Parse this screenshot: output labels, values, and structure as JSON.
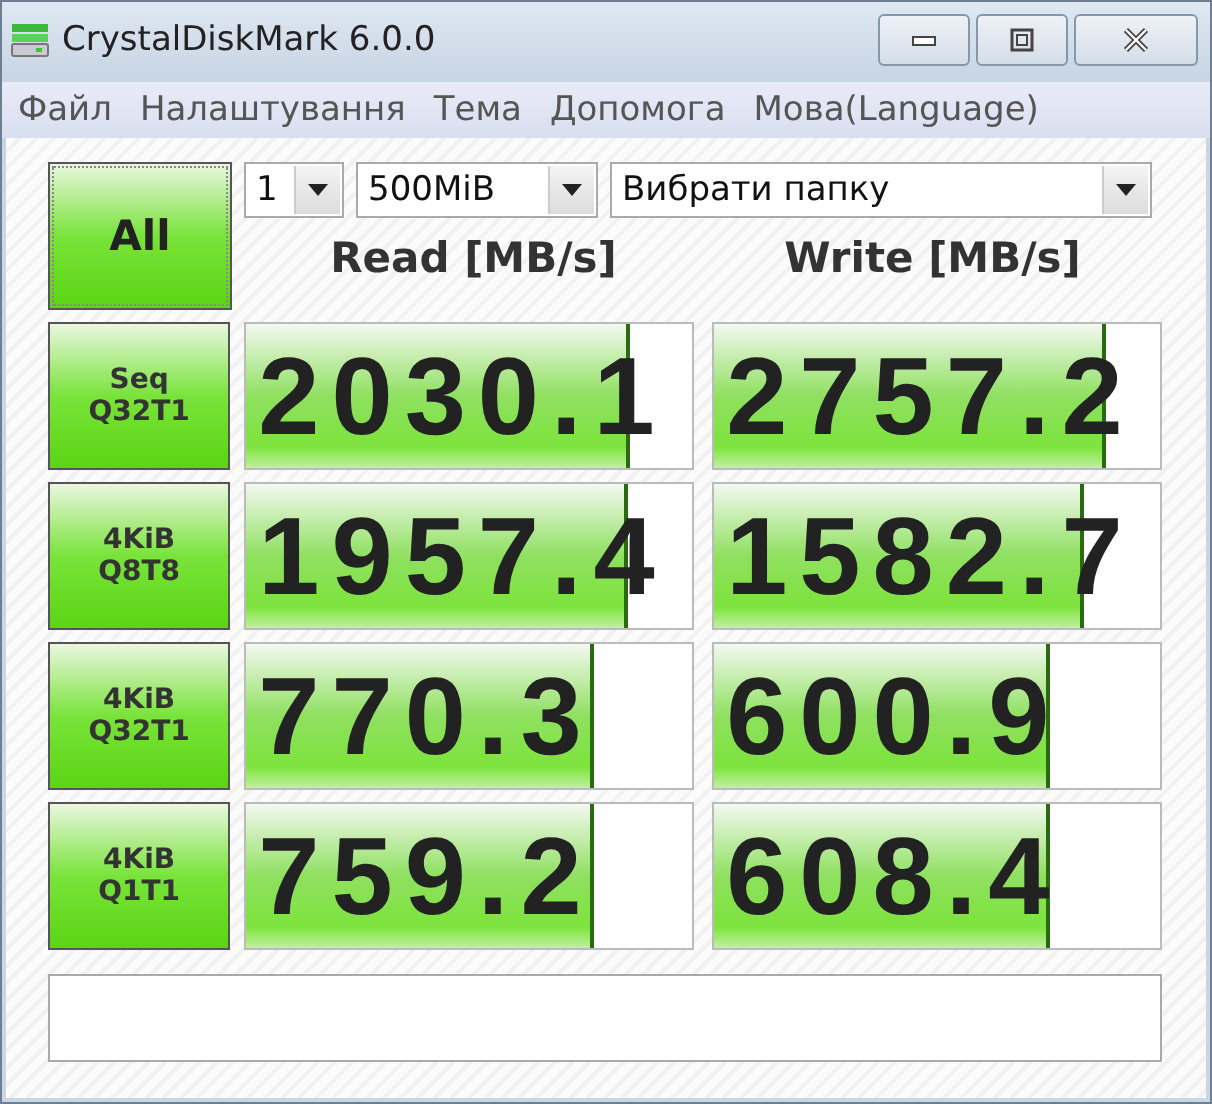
{
  "window": {
    "title": "CrystalDiskMark 6.0.0"
  },
  "menu": [
    "Файл",
    "Налаштування",
    "Тема",
    "Допомога",
    "Мова(Language)"
  ],
  "all_button": {
    "label": "All"
  },
  "selects": [
    {
      "kind": "count",
      "value": "1"
    },
    {
      "kind": "size",
      "value": "500MiB"
    },
    {
      "kind": "folder",
      "value": "Вибрати папку"
    }
  ],
  "columns": [
    "Read [MB/s]",
    "Write [MB/s]"
  ],
  "rows": [
    {
      "label": [
        "Seq",
        "Q32T1"
      ],
      "read": {
        "value": "2030.1",
        "level": 0.85
      },
      "write": {
        "value": "2757.2",
        "level": 0.87
      }
    },
    {
      "label": [
        "4KiB",
        "Q8T8"
      ],
      "read": {
        "value": "1957.4",
        "level": 0.845
      },
      "write": {
        "value": "1582.7",
        "level": 0.82
      }
    },
    {
      "label": [
        "4KiB",
        "Q32T1"
      ],
      "read": {
        "value": "770.3",
        "level": 0.77
      },
      "write": {
        "value": "600.9",
        "level": 0.745
      }
    },
    {
      "label": [
        "4KiB",
        "Q1T1"
      ],
      "read": {
        "value": "759.2",
        "level": 0.77
      },
      "write": {
        "value": "608.4",
        "level": 0.745
      }
    }
  ]
}
